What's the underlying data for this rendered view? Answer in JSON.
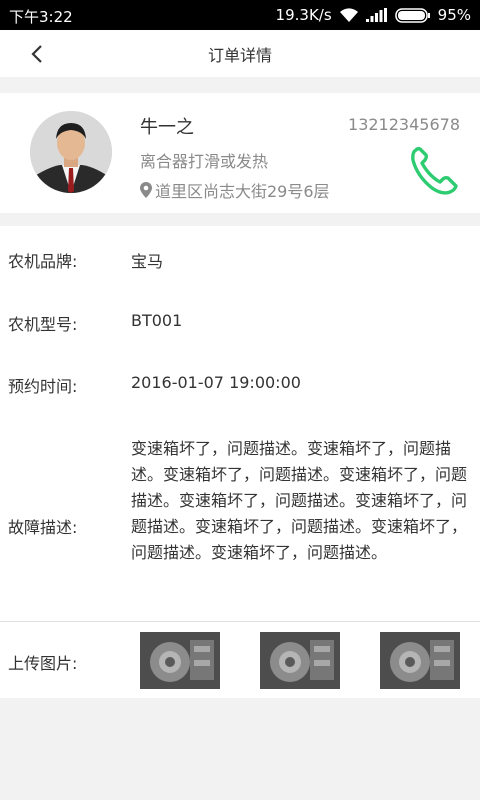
{
  "status_bar": {
    "time": "下午3:22",
    "net_speed": "19.3K/s",
    "battery": "95%"
  },
  "header": {
    "title": "订单详情"
  },
  "customer": {
    "name": "牛一之",
    "phone": "13212345678",
    "issue": "离合器打滑或发热",
    "address": "道里区尚志大街29号6层"
  },
  "order": {
    "brand_label": "农机品牌:",
    "brand_value": "宝马",
    "model_label": "农机型号:",
    "model_value": "BT001",
    "time_label": "预约时间:",
    "time_value": "2016-01-07 19:00:00",
    "desc_label": "故障描述:",
    "desc_value": "变速箱坏了，问题描述。变速箱坏了，问题描述。变速箱坏了，问题描述。变速箱坏了，问题描述。变速箱坏了，问题描述。变速箱坏了，问题描述。变速箱坏了，问题描述。变速箱坏了，问题描述。变速箱坏了，问题描述。",
    "images_label": "上传图片:"
  },
  "colors": {
    "accent": "#2ecc71",
    "status_bar": "#000000",
    "muted_text": "#8a8a8a"
  }
}
